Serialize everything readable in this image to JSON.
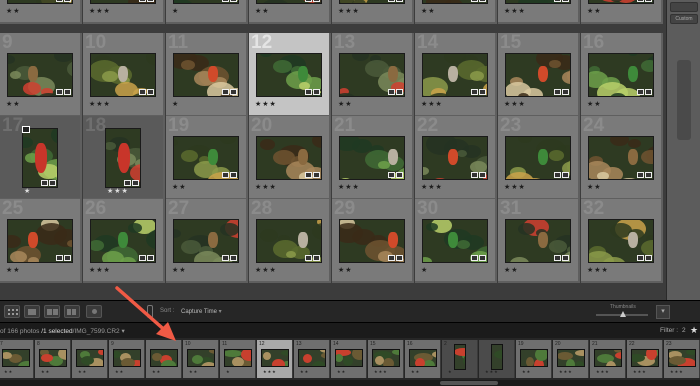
{
  "grid": {
    "rows": [
      {
        "cells": [
          {
            "n": "",
            "stars": "★★"
          },
          {
            "n": "",
            "stars": "★★★"
          },
          {
            "n": "",
            "stars": "★"
          },
          {
            "n": "",
            "stars": "★★"
          },
          {
            "n": "",
            "stars": "★★★"
          },
          {
            "n": "",
            "stars": "★★"
          },
          {
            "n": "",
            "stars": "★★★"
          },
          {
            "n": "",
            "stars": "★★"
          }
        ]
      },
      {
        "cells": [
          {
            "n": "9",
            "stars": "★★"
          },
          {
            "n": "10",
            "stars": "★★★"
          },
          {
            "n": "11",
            "stars": "★"
          },
          {
            "n": "12",
            "stars": "★★★",
            "sel": true
          },
          {
            "n": "13",
            "stars": "★★"
          },
          {
            "n": "14",
            "stars": "★★★"
          },
          {
            "n": "15",
            "stars": "★★★"
          },
          {
            "n": "16",
            "stars": "★★"
          }
        ]
      },
      {
        "cells": [
          {
            "n": "17",
            "stars": "★",
            "sec": true,
            "portrait": true
          },
          {
            "n": "18",
            "stars": "★★★",
            "sec": true,
            "portrait": true
          },
          {
            "n": "19",
            "stars": "★★"
          },
          {
            "n": "20",
            "stars": "★★★"
          },
          {
            "n": "21",
            "stars": "★★★"
          },
          {
            "n": "22",
            "stars": "★★★"
          },
          {
            "n": "23",
            "stars": "★★★"
          },
          {
            "n": "24",
            "stars": "★★"
          }
        ]
      },
      {
        "cells": [
          {
            "n": "25",
            "stars": "★★"
          },
          {
            "n": "26",
            "stars": "★★★"
          },
          {
            "n": "27",
            "stars": "★★"
          },
          {
            "n": "28",
            "stars": "★★★"
          },
          {
            "n": "29",
            "stars": "★★"
          },
          {
            "n": "30",
            "stars": "★"
          },
          {
            "n": "31",
            "stars": "★★"
          },
          {
            "n": "32",
            "stars": "★★★"
          }
        ]
      }
    ]
  },
  "right_panel": {
    "buttons": [
      "",
      "Custom"
    ]
  },
  "toolbar": {
    "sort_label": "Sort :",
    "sort_value": "Capture Time",
    "thumbnails_label": "Thumbnails"
  },
  "filmstrip_header": {
    "photo_count": "of 166 photos",
    "selected": "/1 selected",
    "filename": "/IMG_7599.CR2",
    "filter_label": "Filter :",
    "filter_value": "2"
  },
  "filmstrip": {
    "items": [
      {
        "n": "7",
        "stars": "★★"
      },
      {
        "n": "8",
        "stars": "★★"
      },
      {
        "n": "",
        "stars": "★★"
      },
      {
        "n": "9",
        "stars": "★★"
      },
      {
        "n": "",
        "stars": "★★"
      },
      {
        "n": "10",
        "stars": "★★"
      },
      {
        "n": "11",
        "stars": "★"
      },
      {
        "n": "12",
        "stars": "★★★",
        "sel": true
      },
      {
        "n": "13",
        "stars": "★★"
      },
      {
        "n": "14",
        "stars": "★★"
      },
      {
        "n": "15",
        "stars": "★★★"
      },
      {
        "n": "16",
        "stars": "★★"
      },
      {
        "n": "2",
        "stars": "★",
        "sec": true
      },
      {
        "n": "",
        "stars": "★★★",
        "sec": true
      },
      {
        "n": "19",
        "stars": "★★"
      },
      {
        "n": "20",
        "stars": "★★★"
      },
      {
        "n": "21",
        "stars": "★★★"
      },
      {
        "n": "22",
        "stars": "★★★"
      },
      {
        "n": "23",
        "stars": "★★★"
      }
    ]
  },
  "colors": {
    "grid_cell": "#7a7a7a",
    "selected_cell": "#c4c4c4",
    "annotation_arrow": "#f05a45"
  }
}
